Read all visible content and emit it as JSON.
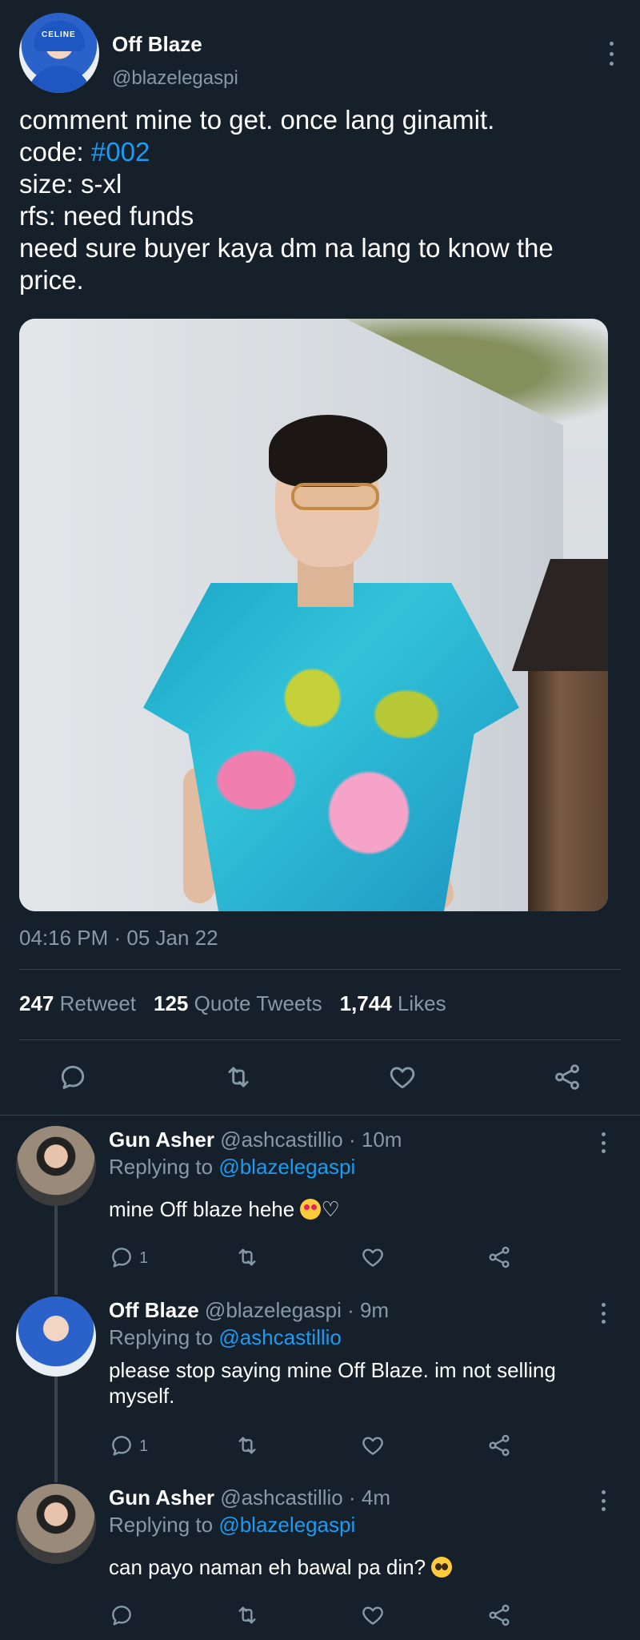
{
  "tweet": {
    "author_name": "Off Blaze",
    "author_handle": "@blazelegaspi",
    "avatar_hood_text": "CELINE",
    "lines": [
      "comment mine to get. once lang ginamit.",
      "code: ",
      "size: s-xl",
      "rfs: need funds",
      "need sure buyer kaya dm na lang to know the",
      "price."
    ],
    "hashtag": "#002",
    "timestamp": "04:16 PM · 05 Jan 22",
    "stats": {
      "retweets": "247",
      "retweets_label": "Retweet",
      "quotes": "125",
      "quotes_label": "Quote Tweets",
      "likes": "1,744",
      "likes_label": "Likes"
    }
  },
  "replies": [
    {
      "name": "Gun Asher",
      "meta": "@ashcastillio · 10m",
      "replying_label": "Replying to ",
      "replying_to": "@blazelegaspi",
      "text": "mine Off blaze hehe ",
      "emoji": [
        "heart-eyes",
        "white-heart"
      ],
      "reply_count": "1"
    },
    {
      "name": "Off Blaze",
      "meta": "@blazelegaspi · 9m",
      "replying_label": "Replying to ",
      "replying_to": "@ashcastillio",
      "text": "please stop saying mine Off Blaze. im not selling myself.",
      "reply_count": "1"
    },
    {
      "name": "Gun Asher",
      "meta": "@ashcastillio · 4m",
      "replying_label": "Replying to ",
      "replying_to": "@blazelegaspi",
      "text": "can payo naman eh bawal pa din? ",
      "emoji": [
        "pleading"
      ],
      "reply_count": ""
    }
  ],
  "icons": {
    "reply": "reply-icon",
    "retweet": "retweet-icon",
    "like": "like-icon",
    "share": "share-icon",
    "more": "more-icon"
  },
  "colors": {
    "background": "#15202b",
    "muted": "#8899a6",
    "link": "#1d9bf0",
    "divider": "#38444d"
  }
}
